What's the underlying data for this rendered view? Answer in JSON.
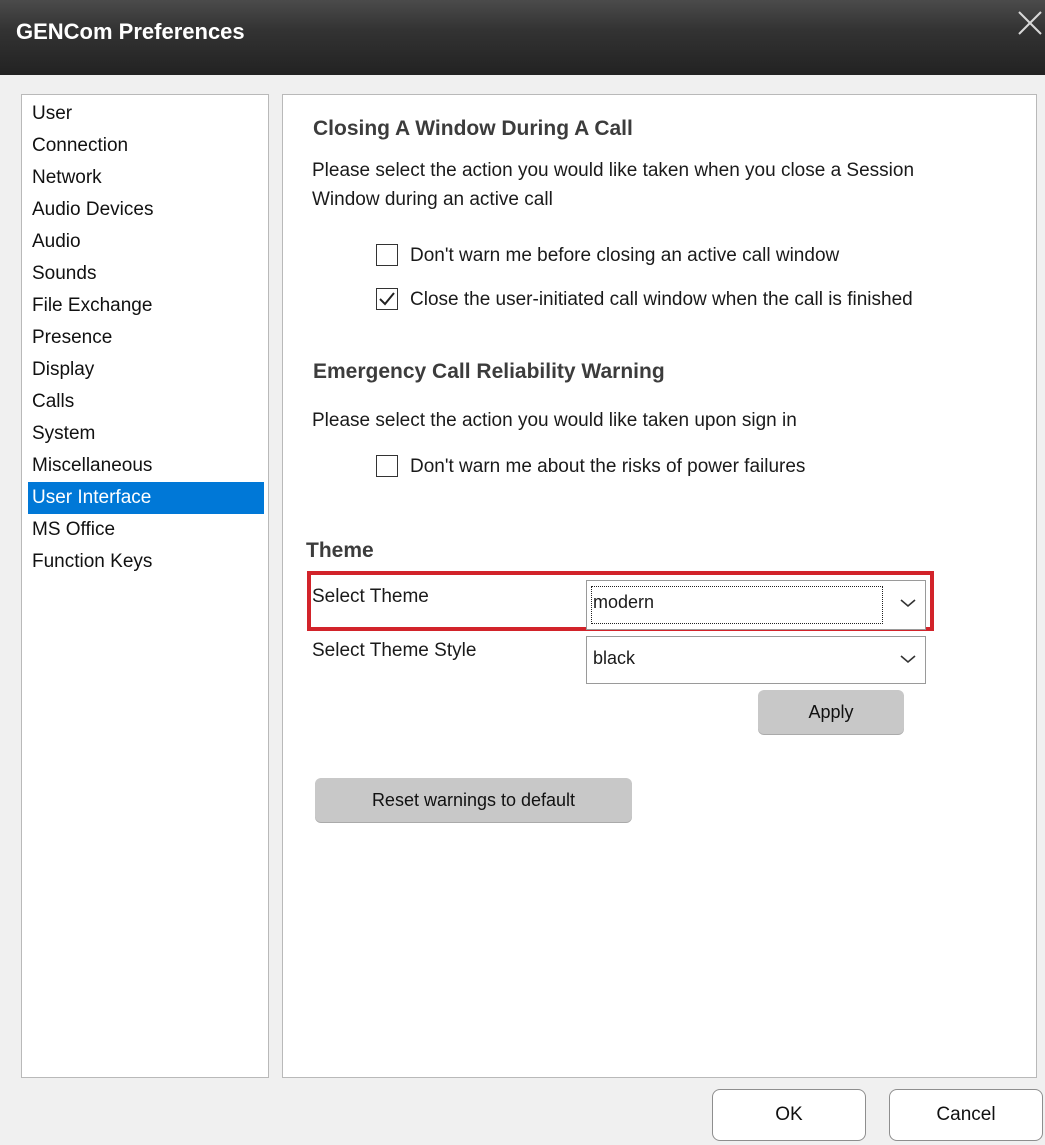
{
  "window": {
    "title": "GENCom Preferences"
  },
  "sidebar": {
    "items": [
      {
        "label": "User"
      },
      {
        "label": "Connection"
      },
      {
        "label": "Network"
      },
      {
        "label": "Audio Devices"
      },
      {
        "label": "Audio"
      },
      {
        "label": "Sounds"
      },
      {
        "label": "File Exchange"
      },
      {
        "label": "Presence"
      },
      {
        "label": "Display"
      },
      {
        "label": "Calls"
      },
      {
        "label": "System"
      },
      {
        "label": "Miscellaneous"
      },
      {
        "label": "User Interface",
        "selected": true
      },
      {
        "label": "MS Office"
      },
      {
        "label": "Function Keys"
      }
    ]
  },
  "closing": {
    "heading": "Closing A Window During A Call",
    "description_line1": "Please select the action you would like taken when you close a Session",
    "description_line2": "Window during an active call",
    "options": [
      {
        "label": "Don't warn me before closing an active call window",
        "checked": false
      },
      {
        "label": "Close the user-initiated call window when the call is finished",
        "checked": true
      }
    ]
  },
  "emergency": {
    "heading": "Emergency Call Reliability Warning",
    "description": "Please select the action you would like taken upon sign in",
    "options": [
      {
        "label": "Don't warn me about the risks of power failures",
        "checked": false
      }
    ]
  },
  "theme": {
    "heading": "Theme",
    "select_theme_label": "Select Theme",
    "select_theme_value": "modern",
    "select_style_label": "Select Theme Style",
    "select_style_value": "black",
    "apply_label": "Apply"
  },
  "reset_label": "Reset warnings to default",
  "footer": {
    "ok_label": "OK",
    "cancel_label": "Cancel"
  },
  "colors": {
    "selection": "#0078d7",
    "highlight_border": "#d2232a",
    "titlebar": "#333333"
  }
}
